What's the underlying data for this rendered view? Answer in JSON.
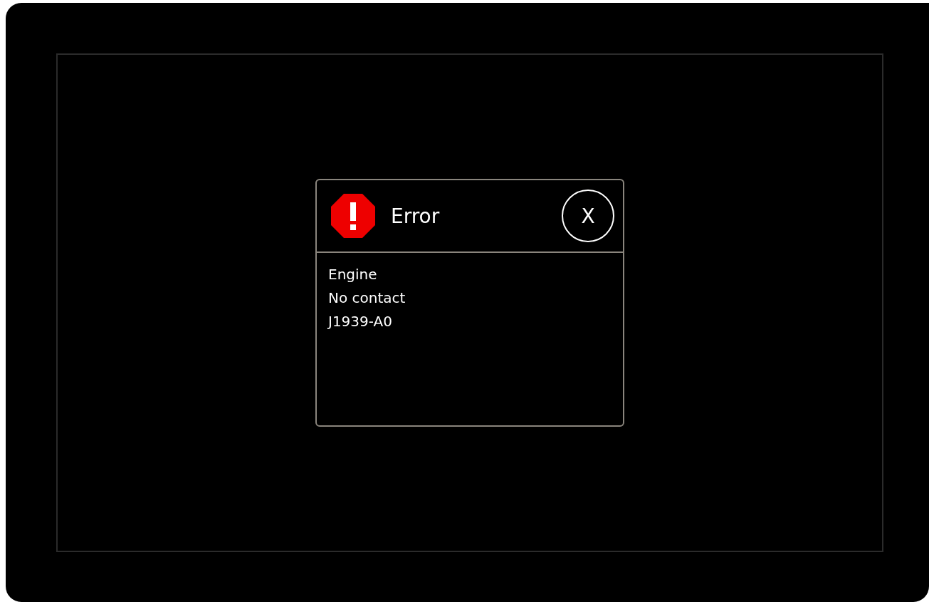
{
  "dialog": {
    "kind": "error",
    "title": "Error",
    "close_label": "X",
    "lines": [
      "Engine",
      "No contact",
      "J1939-A0"
    ]
  }
}
